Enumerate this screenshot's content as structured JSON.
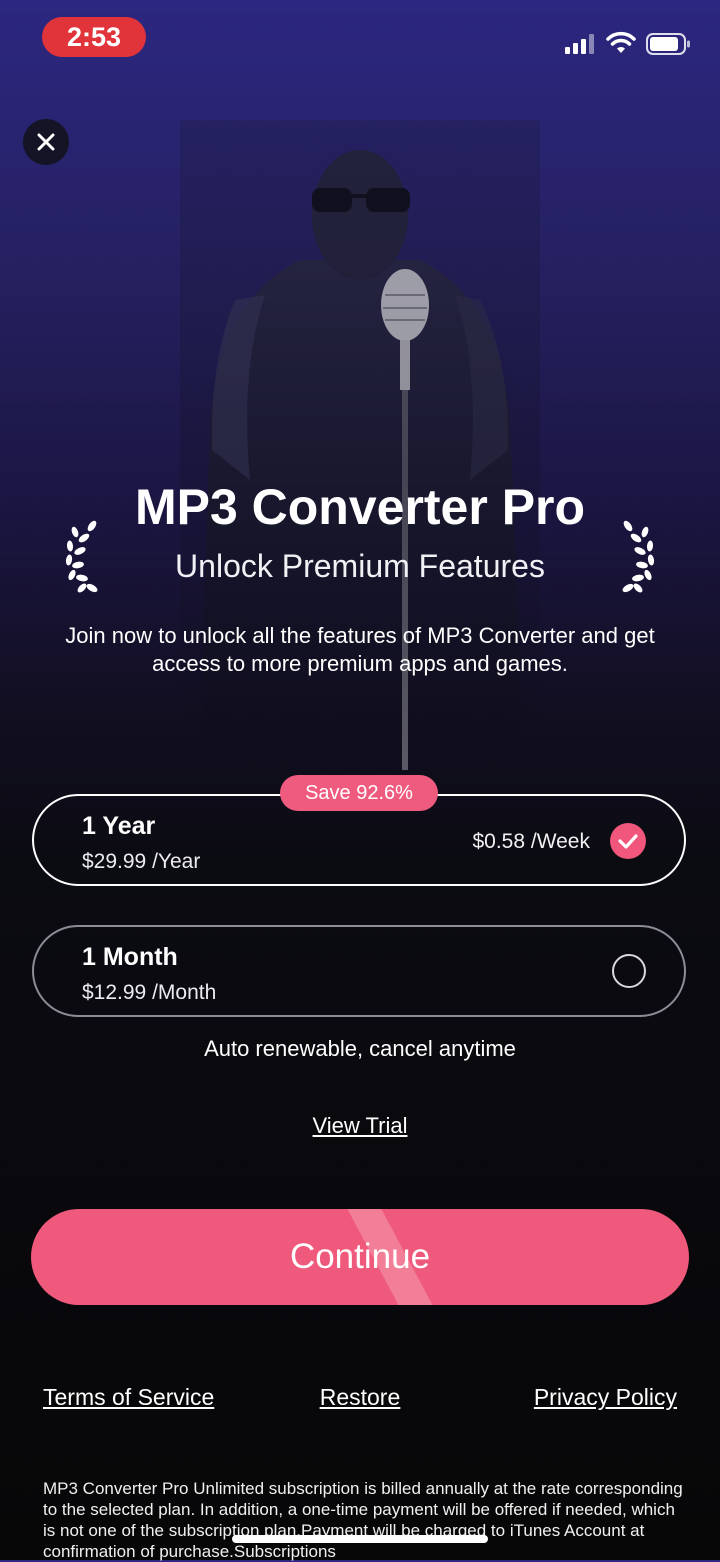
{
  "status_bar": {
    "time": "2:53"
  },
  "header": {
    "title": "MP3 Converter Pro",
    "subtitle": "Unlock Premium Features",
    "description": "Join now to unlock all the features of MP3 Converter and get access to more premium apps and games."
  },
  "plans": [
    {
      "name": "1 Year",
      "price": "$29.99 /Year",
      "weekly": "$0.58 /Week",
      "badge": "Save 92.6%",
      "selected": true
    },
    {
      "name": "1 Month",
      "price": "$12.99 /Month",
      "selected": false
    }
  ],
  "auto_renew_text": "Auto renewable, cancel anytime",
  "view_trial_label": "View Trial",
  "continue_label": "Continue",
  "footer_links": {
    "terms": "Terms of Service",
    "restore": "Restore",
    "privacy": "Privacy Policy"
  },
  "legal_text": "MP3 Converter Pro Unlimited subscription is billed annually at the rate corresponding to the selected plan. In addition, a one-time payment will be offered if needed, which is not one of the subscription plan.Payment will be charged to iTunes Account at confirmation of purchase.Subscriptions",
  "colors": {
    "accent": "#ef5a7c",
    "time_pill": "#e0343a"
  },
  "icons": {
    "close": "close-icon",
    "check": "checkmark-icon",
    "laurel": "laurel-icon"
  }
}
